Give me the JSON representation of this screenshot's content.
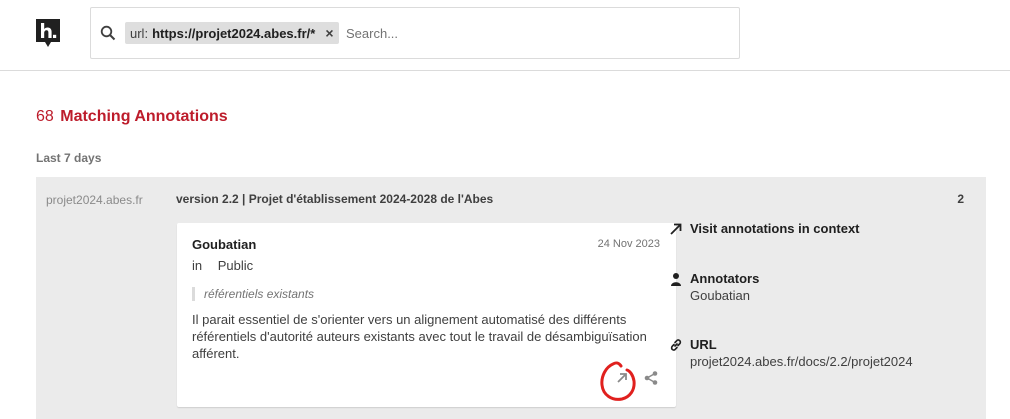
{
  "app": {
    "logo_icon": "hypothesis-logo-icon"
  },
  "search": {
    "icon": "search-icon",
    "chip_key": "url:",
    "chip_value": "https://projet2024.abes.fr/*",
    "chip_remove": "×",
    "placeholder": "Search..."
  },
  "results": {
    "count": "68",
    "label": "Matching Annotations"
  },
  "period": "Last 7 days",
  "bucket": {
    "domain": "projet2024.abes.fr",
    "title": "version 2.2 | Projet d'établissement 2024-2028 de l'Abes",
    "count": "2"
  },
  "annotation": {
    "author": "Goubatian",
    "date": "24 Nov 2023",
    "group_prefix": "in",
    "group": "Public",
    "quote": "référentiels existants",
    "text": "Il parait essentiel de s'orienter vers un alignement automatisé des différents référentiels d'autorité auteurs existants avec tout le travail de désambiguïsation afférent."
  },
  "sidebar": {
    "visit_label": "Visit annotations in context",
    "annotators_label": "Annotators",
    "annotators_value": "Goubatian",
    "url_label": "URL",
    "url_value": "projet2024.abes.fr/docs/2.2/projet2024"
  },
  "colors": {
    "accent": "#bd1c2b",
    "bucket_bg": "#ebebeb",
    "highlight_mark": "#e0201e"
  }
}
